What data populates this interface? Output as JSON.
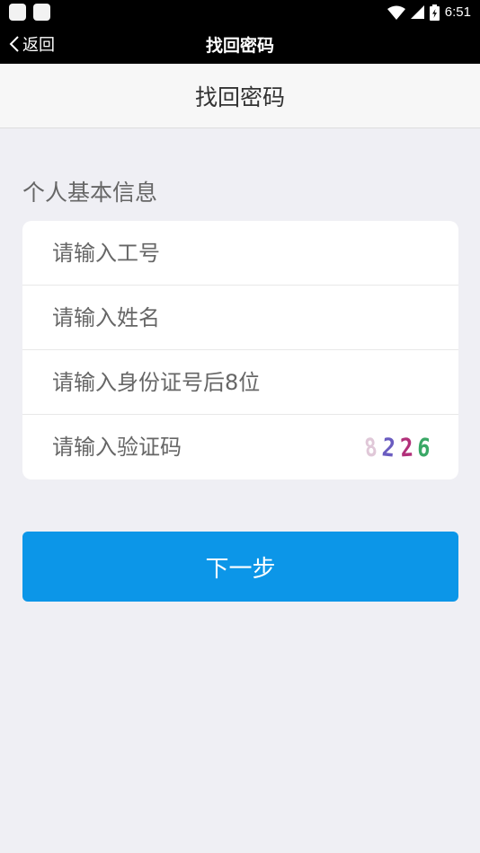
{
  "status_bar": {
    "time": "6:51",
    "icons": [
      "notification-icon",
      "notification-icon",
      "wifi-icon",
      "signal-icon",
      "battery-icon"
    ]
  },
  "nav": {
    "back_label": "返回",
    "title": "找回密码"
  },
  "header": {
    "title": "找回密码"
  },
  "form": {
    "section_label": "个人基本信息",
    "employee_id_placeholder": "请输入工号",
    "name_placeholder": "请输入姓名",
    "id_last8_placeholder": "请输入身份证号后8位",
    "captcha_placeholder": "请输入验证码",
    "captcha_digits": [
      "8",
      "2",
      "2",
      "6"
    ]
  },
  "actions": {
    "next_label": "下一步"
  },
  "colors": {
    "primary": "#0c96e8",
    "background": "#efeff4",
    "bar": "#000000"
  }
}
